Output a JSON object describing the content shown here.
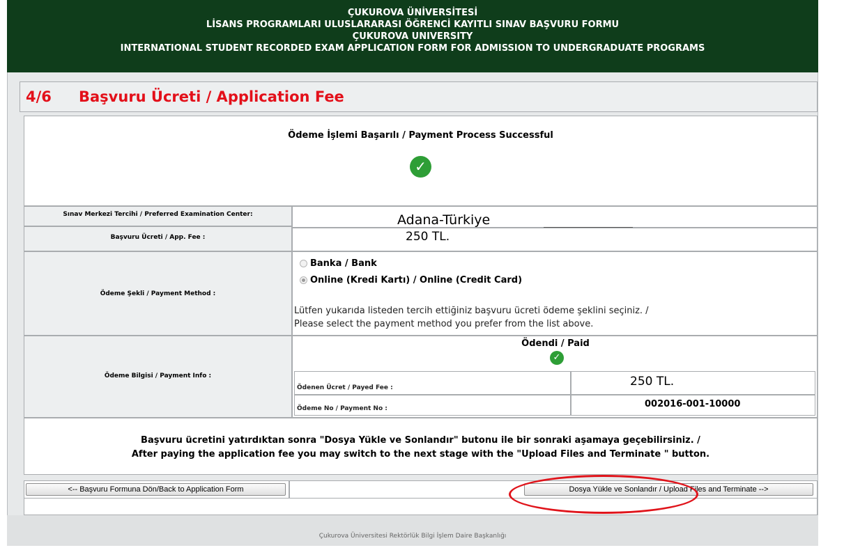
{
  "header": {
    "line1": "ÇUKUROVA ÜNİVERSİTESİ",
    "line2": "LİSANS PROGRAMLARI ULUSLARARASI ÖĞRENCİ KAYITLI SINAV BAŞVURU FORMU",
    "line3": "ÇUKUROVA UNIVERSITY",
    "line4": "INTERNATIONAL STUDENT RECORDED EXAM APPLICATION FORM FOR ADMISSION TO UNDERGRADUATE PROGRAMS"
  },
  "step": {
    "number": "4/6",
    "title": "Başvuru Ücreti / Application Fee"
  },
  "success": {
    "message": "Ödeme İşlemi Başarılı / Payment Process Successful",
    "icon": "check-circle-icon"
  },
  "exam_center": {
    "label": "Sınav Merkezi Tercihi / Preferred Examination Center:",
    "value": "Adana-Türkiye"
  },
  "app_fee": {
    "label": "Başvuru Ücreti / App. Fee :",
    "value": "250 TL."
  },
  "payment_method": {
    "label": "Ödeme Şekli / Payment Method :",
    "options": [
      {
        "label": "Banka / Bank",
        "selected": false
      },
      {
        "label": "Online (Kredi Kartı) / Online (Credit Card)",
        "selected": true
      }
    ],
    "hint_line1": "Lütfen yukarıda listeden tercih ettiğiniz başvuru ücreti ödeme şeklini seçiniz. /",
    "hint_line2": "Please select the payment method you prefer from the list above."
  },
  "payment_info": {
    "label": "Ödeme Bilgisi / Payment Info :",
    "status": "Ödendi / Paid",
    "paid_fee_label": "Ödenen Ücret / Payed Fee :",
    "paid_fee_value": "250 TL.",
    "payment_no_label": "Ödeme No / Payment No :",
    "payment_no_value": "002016-001-10000"
  },
  "notice": {
    "line1": "Başvuru ücretini yatırdıktan sonra \"Dosya Yükle ve Sonlandır\" butonu ile bir sonraki aşamaya geçebilirsiniz. /",
    "line2": "After paying the application fee you may switch to the next stage with the \"Upload Files and Terminate \" button."
  },
  "buttons": {
    "back": "<-- Başvuru Formuna Dön/Back to Application Form",
    "next": "Dosya Yükle ve Sonlandır / Upload Files and Terminate -->"
  },
  "footer": "Çukurova Üniversitesi Rektörlük Bilgi İşlem Daire Başkanlığı",
  "colors": {
    "header_bg": "#0f3d1b",
    "title_red": "#e3101a",
    "check_green": "#2e9e36",
    "highlight_red": "#e0141b"
  }
}
